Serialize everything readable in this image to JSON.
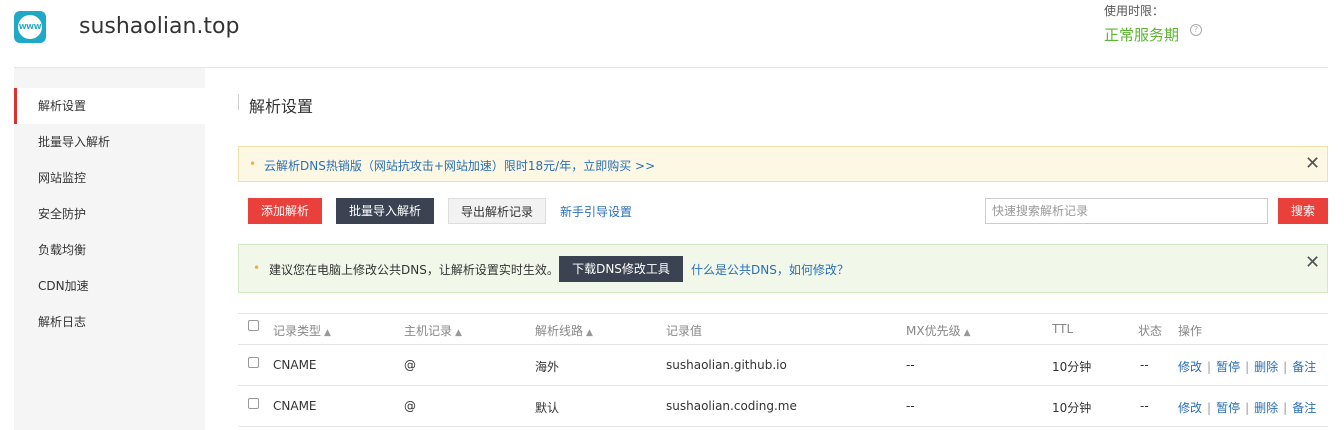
{
  "header": {
    "logo_text": "WWW",
    "domain": "sushaolian.top",
    "usage_label": "使用时限：",
    "usage_status": "正常服务期",
    "help_glyph": "?"
  },
  "sidebar": {
    "items": [
      {
        "label": "解析设置",
        "active": true
      },
      {
        "label": "批量导入解析"
      },
      {
        "label": "网站监控"
      },
      {
        "label": "安全防护"
      },
      {
        "label": "负载均衡"
      },
      {
        "label": "CDN加速"
      },
      {
        "label": "解析日志"
      }
    ]
  },
  "main": {
    "title": "解析设置",
    "promo": {
      "dot": "•",
      "text": "云解析DNS热销版（网站抗攻击+网站加速）限时18元/年，立即购买 >>",
      "close": "✕"
    },
    "toolbar": {
      "add": "添加解析",
      "batch_import": "批量导入解析",
      "export": "导出解析记录",
      "guide": "新手引导设置",
      "search_placeholder": "快速搜索解析记录",
      "search_button": "搜索"
    },
    "tip": {
      "dot": "•",
      "text": "建议您在电脑上修改公共DNS，让解析设置实时生效。",
      "download_button": "下载DNS修改工具",
      "link": "什么是公共DNS，如何修改？",
      "close": "✕"
    }
  },
  "table": {
    "sort_glyph": "▲",
    "headers": {
      "type": "记录类型",
      "host": "主机记录",
      "line": "解析线路",
      "value": "记录值",
      "mx": "MX优先级",
      "ttl": "TTL",
      "status": "状态",
      "ops": "操作"
    },
    "rows": [
      {
        "type": "CNAME",
        "host": "@",
        "line": "海外",
        "value": "sushaolian.github.io",
        "mx": "--",
        "ttl": "10分钟",
        "status": "--"
      },
      {
        "type": "CNAME",
        "host": "@",
        "line": "默认",
        "value": "sushaolian.coding.me",
        "mx": "--",
        "ttl": "10分钟",
        "status": "--"
      }
    ],
    "actions": {
      "edit": "修改",
      "pause": "暂停",
      "delete": "删除",
      "note": "备注",
      "separator": "|"
    }
  },
  "colors": {
    "accent_red": "#e9403c",
    "dark_button": "#3b4352",
    "link_blue": "#2a6fb5",
    "status_green": "#5cb531"
  }
}
